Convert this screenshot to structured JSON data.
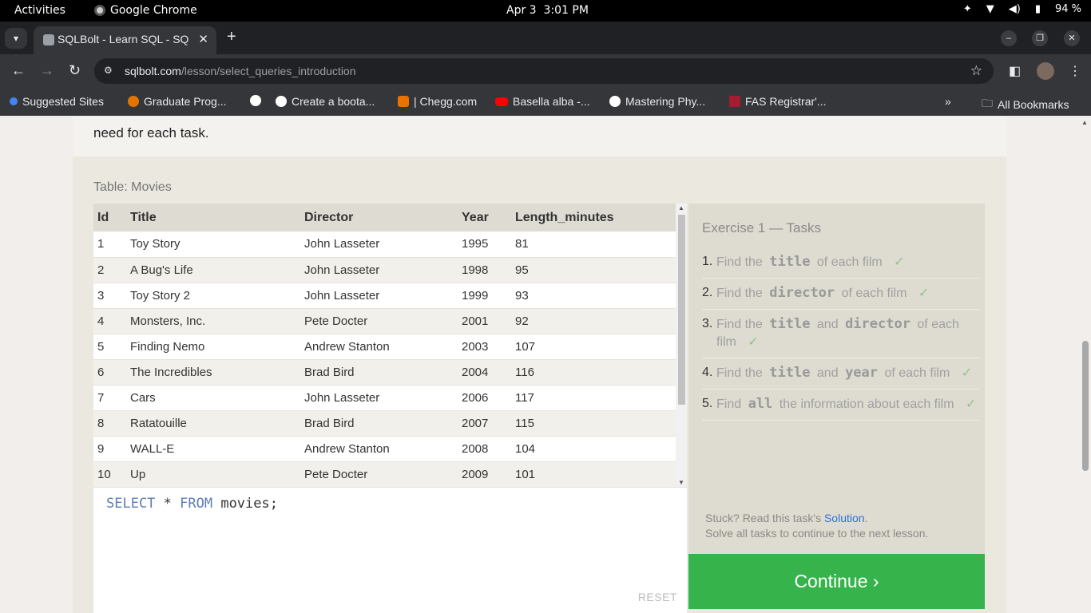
{
  "os": {
    "activities": "Activities",
    "app_name": "Google Chrome",
    "date": "Apr 3",
    "time": "3:01 PM",
    "battery": "94 %"
  },
  "browser": {
    "tab_title": "SQLBolt - Learn SQL - SQ",
    "url_host": "sqlbolt.com",
    "url_path": "/lesson/select_queries_introduction",
    "bookmarks": [
      {
        "label": "Suggested Sites",
        "color": "#4285f4"
      },
      {
        "label": "Graduate Prog...",
        "color": "#e37400"
      },
      {
        "label": "",
        "color": "#ffffff"
      },
      {
        "label": "Create a boota...",
        "color": "#ffffff"
      },
      {
        "label": "| Chegg.com",
        "color": "#eb7100"
      },
      {
        "label": "Basella alba -...",
        "color": "#ff0000"
      },
      {
        "label": "Mastering Phy...",
        "color": "#ffffff"
      },
      {
        "label": "FAS Registrar'...",
        "color": "#a51c30"
      }
    ],
    "all_bookmarks": "All Bookmarks"
  },
  "page": {
    "intro_tail": "need for each task.",
    "table_caption": "Table: Movies",
    "table": {
      "headers": [
        "Id",
        "Title",
        "Director",
        "Year",
        "Length_minutes"
      ],
      "rows": [
        [
          "1",
          "Toy Story",
          "John Lasseter",
          "1995",
          "81"
        ],
        [
          "2",
          "A Bug's Life",
          "John Lasseter",
          "1998",
          "95"
        ],
        [
          "3",
          "Toy Story 2",
          "John Lasseter",
          "1999",
          "93"
        ],
        [
          "4",
          "Monsters, Inc.",
          "Pete Docter",
          "2001",
          "92"
        ],
        [
          "5",
          "Finding Nemo",
          "Andrew Stanton",
          "2003",
          "107"
        ],
        [
          "6",
          "The Incredibles",
          "Brad Bird",
          "2004",
          "116"
        ],
        [
          "7",
          "Cars",
          "John Lasseter",
          "2006",
          "117"
        ],
        [
          "8",
          "Ratatouille",
          "Brad Bird",
          "2007",
          "115"
        ],
        [
          "9",
          "WALL-E",
          "Andrew Stanton",
          "2008",
          "104"
        ],
        [
          "10",
          "Up",
          "Pete Docter",
          "2009",
          "101"
        ]
      ]
    },
    "editor": {
      "kw1": "SELECT",
      "mid": " * ",
      "kw2": "FROM",
      "rest": " movies;",
      "reset": "RESET"
    },
    "tasks": {
      "heading": "Exercise 1 — Tasks",
      "items": [
        {
          "num": "1.",
          "pre": "Find the",
          "code1": "title",
          "mid": "",
          "code2": "",
          "post": "of each film",
          "check": "✓"
        },
        {
          "num": "2.",
          "pre": "Find the",
          "code1": "director",
          "mid": "",
          "code2": "",
          "post": "of each film",
          "check": "✓"
        },
        {
          "num": "3.",
          "pre": "Find the",
          "code1": "title",
          "mid": "and",
          "code2": "director",
          "post": "of each film",
          "check": "✓"
        },
        {
          "num": "4.",
          "pre": "Find the",
          "code1": "title",
          "mid": "and",
          "code2": "year",
          "post": "of each film",
          "check": "✓"
        },
        {
          "num": "5.",
          "pre": "Find",
          "code1": "all",
          "mid": "",
          "code2": "",
          "post": "the information about each film",
          "check": "✓"
        }
      ],
      "stuck_pre": "Stuck? Read this task's ",
      "solution_link": "Solution",
      "stuck_post": ".",
      "solve_all": "Solve all tasks to continue to the next lesson."
    },
    "continue_label": "Continue ›"
  }
}
